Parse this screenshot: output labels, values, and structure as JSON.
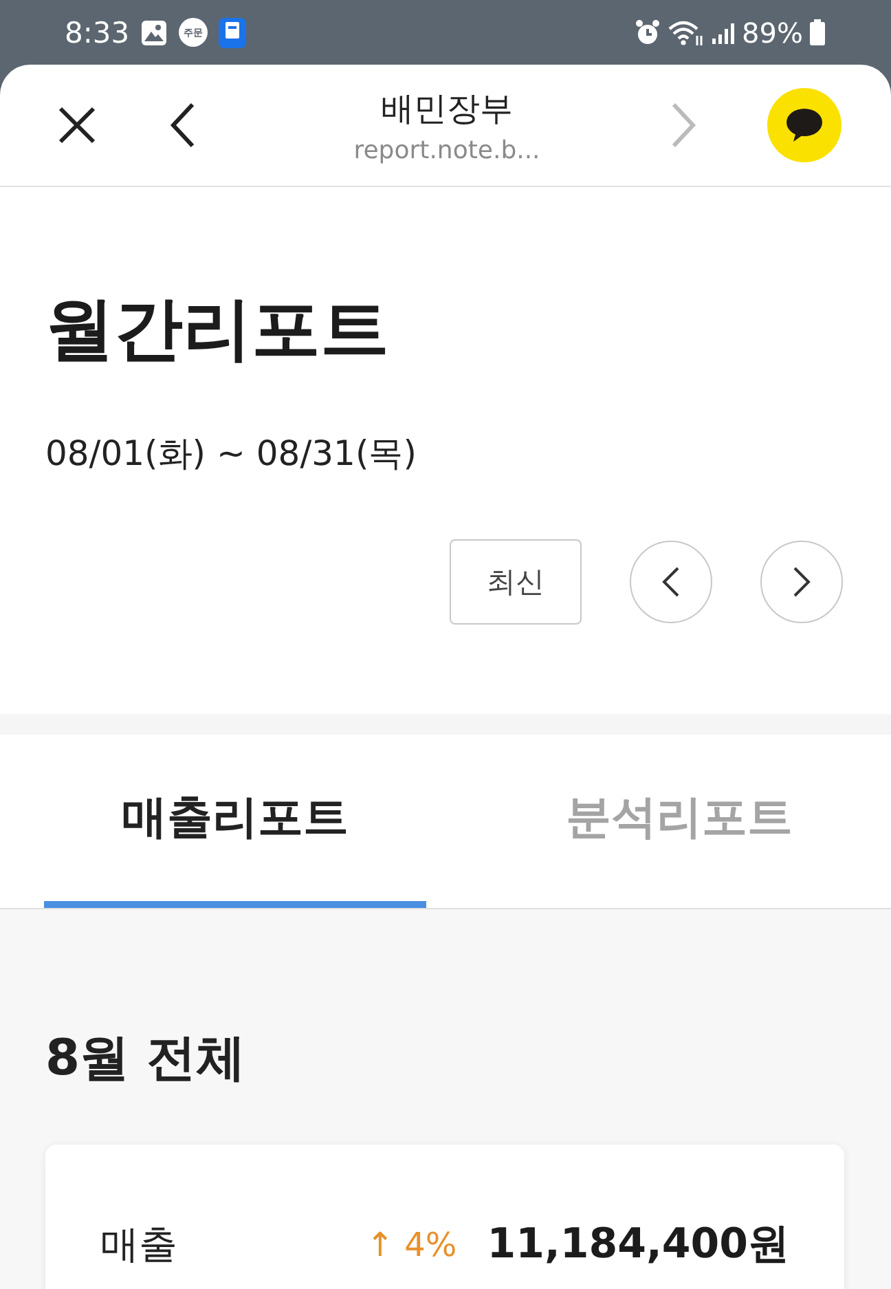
{
  "status_bar": {
    "time": "8:33",
    "notification_badge": "주문",
    "battery": "89%"
  },
  "browser_bar": {
    "title": "배민장부",
    "url": "report.note.b...",
    "forward_disabled": true
  },
  "report": {
    "title": "월간리포트",
    "period": "08/01(화) ~ 08/31(목)",
    "latest_button": "최신"
  },
  "tabs": [
    {
      "label": "매출리포트",
      "selected": true
    },
    {
      "label": "분석리포트",
      "selected": false
    }
  ],
  "summary": {
    "heading": "8월 전체",
    "rows": [
      {
        "label": "매출",
        "change": "↑ 4%",
        "increase": true,
        "amount": "11,184,400원"
      }
    ]
  }
}
